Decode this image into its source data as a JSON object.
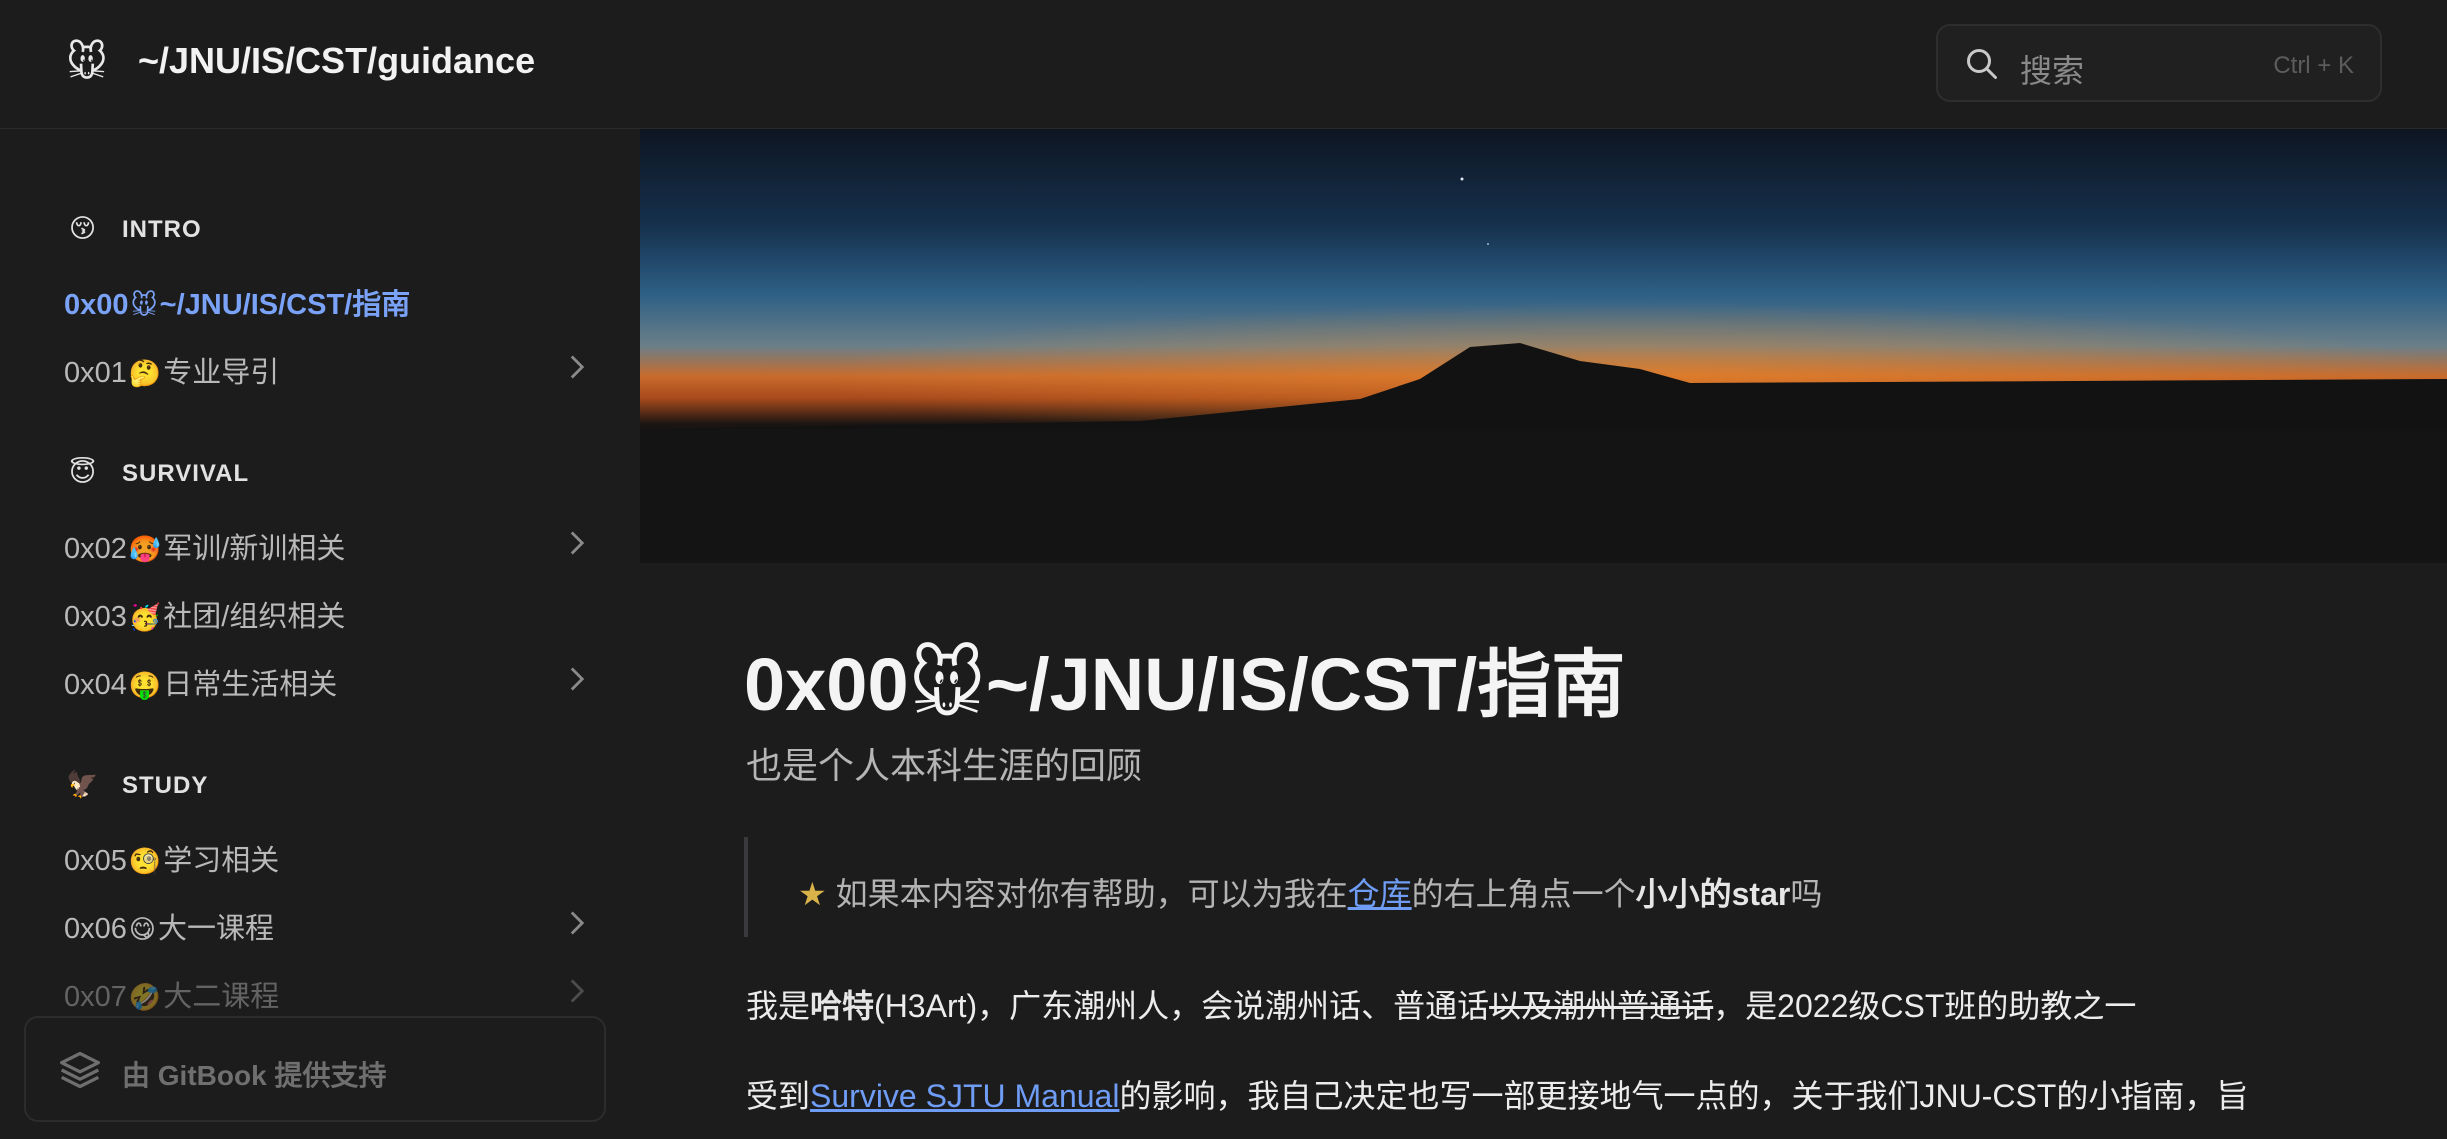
{
  "header": {
    "logo_emoji": "🐭",
    "site_title": "~/JNU/IS/CST/guidance",
    "search": {
      "placeholder": "搜索",
      "shortcut": "Ctrl + K",
      "icon": "search-icon"
    }
  },
  "sidebar": {
    "sections": [
      {
        "emoji": "😚",
        "title": "INTRO"
      },
      {
        "emoji": "😇",
        "title": "SURVIVAL"
      },
      {
        "emoji": "🦅",
        "title": "STUDY"
      }
    ],
    "items": [
      {
        "num": "0x00",
        "emoji": "🐭",
        "label": "~/JNU/IS/CST/指南",
        "active": true
      },
      {
        "num": "0x01",
        "emoji": "🤔",
        "label": "专业导引",
        "expandable": true
      },
      {
        "num": "0x02",
        "emoji": "🥵",
        "label": "军训/新训相关",
        "expandable": true
      },
      {
        "num": "0x03",
        "emoji": "🥳",
        "label": "社团/组织相关"
      },
      {
        "num": "0x04",
        "emoji": "🤑",
        "label": "日常生活相关",
        "expandable": true
      },
      {
        "num": "0x05",
        "emoji": "🧐",
        "label": "学习相关"
      },
      {
        "num": "0x06",
        "emoji": "😋",
        "label": "大一课程",
        "expandable": true
      },
      {
        "num": "0x07",
        "emoji": "🤣",
        "label": "大二课程",
        "expandable": true
      }
    ],
    "footer": {
      "label": "由 GitBook 提供支持",
      "icon": "gitbook-icon"
    }
  },
  "page": {
    "title_num": "0x00",
    "title_emoji": "🐭",
    "title_text": "~/JNU/IS/CST/指南",
    "subtitle": "也是个人本科生涯的回顾",
    "hint": {
      "star": "★",
      "before": "如果本内容对你有帮助，可以为我在",
      "link": "仓库",
      "middle": "的右上角点一个",
      "bold": "小小的star",
      "after": "吗"
    },
    "para1": {
      "a": "我是",
      "name": "哈特",
      "b": "(H3Art)，广东潮州人，会说潮州话、普通话",
      "strike": "以及潮州普通话",
      "c": "，是2022级CST班的助教之一"
    },
    "para2": {
      "a": "受到",
      "link": "Survive SJTU Manual",
      "b": "的影响，我自己决定也写一部更接地气一点的，关于我们JNU-CST的小指南，旨"
    }
  },
  "colors": {
    "accent": "#7aa2f7",
    "background": "#1c1c1d",
    "link": "#6f9cf5"
  }
}
